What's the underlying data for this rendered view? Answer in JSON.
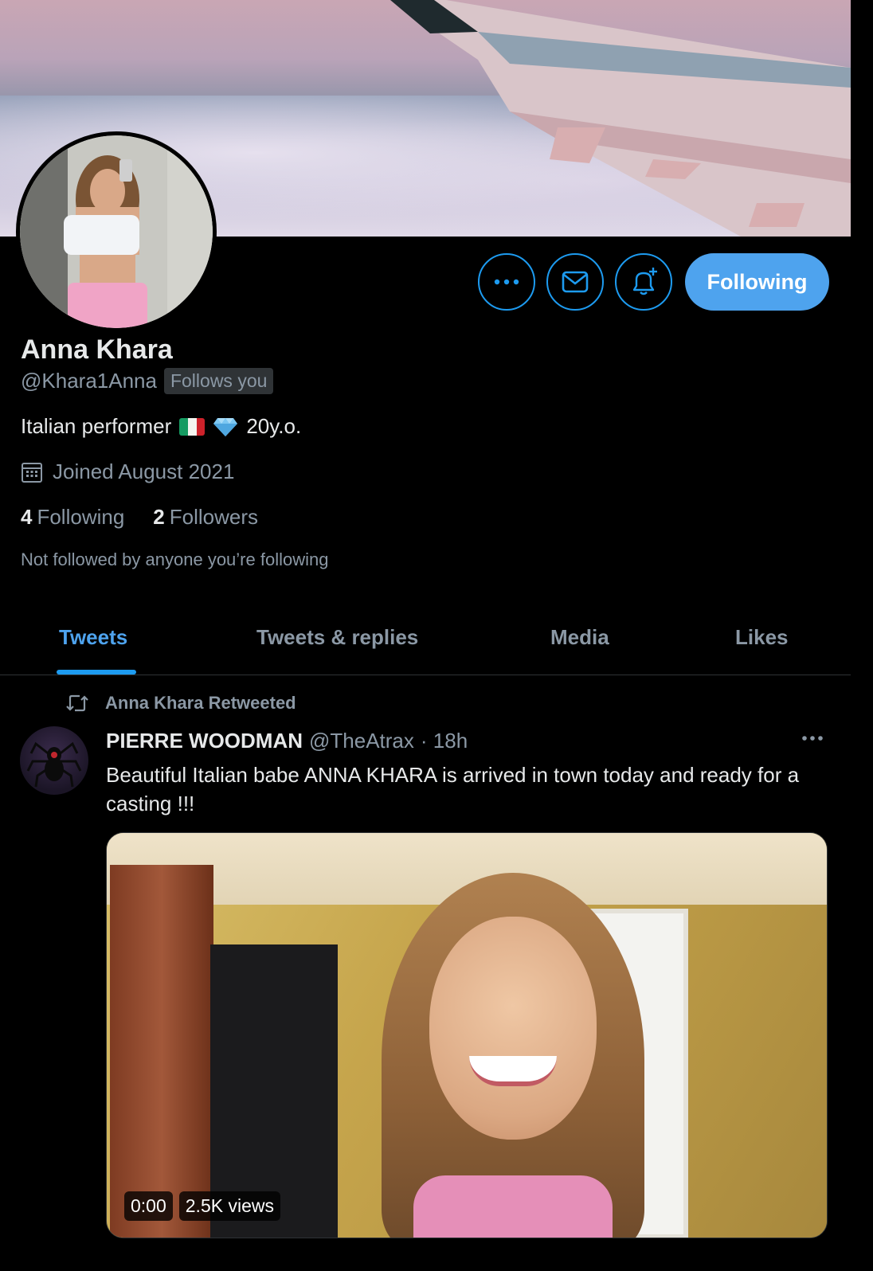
{
  "profile": {
    "name": "Anna Khara",
    "handle": "@Khara1Anna",
    "follows_you": "Follows you",
    "bio_text": "Italian performer",
    "bio_age": "20y.o.",
    "joined": "Joined August 2021",
    "following_count": "4",
    "following_label": "Following",
    "followers_count": "2",
    "followers_label": "Followers",
    "not_followed": "Not followed by anyone you’re following"
  },
  "actions": {
    "follow_button": "Following"
  },
  "tabs": [
    {
      "label": "Tweets"
    },
    {
      "label": "Tweets & replies"
    },
    {
      "label": "Media"
    },
    {
      "label": "Likes"
    }
  ],
  "tweet": {
    "retweeted_by": "Anna Khara Retweeted",
    "author_name": "PIERRE WOODMAN",
    "author_handle": "@TheAtrax",
    "time": "· 18h",
    "text": "Beautiful Italian babe ANNA KHARA is arrived in town today and ready for a casting !!!",
    "video_time": "0:00",
    "video_views": "2.5K views"
  },
  "colors": {
    "accent": "#1d9bf0",
    "background": "#000000",
    "secondary_text": "#8b98a5"
  },
  "icons": [
    "more-icon",
    "mail-icon",
    "bell-plus-icon",
    "calendar-icon",
    "retweet-icon",
    "italy-flag-icon",
    "gem-icon"
  ]
}
